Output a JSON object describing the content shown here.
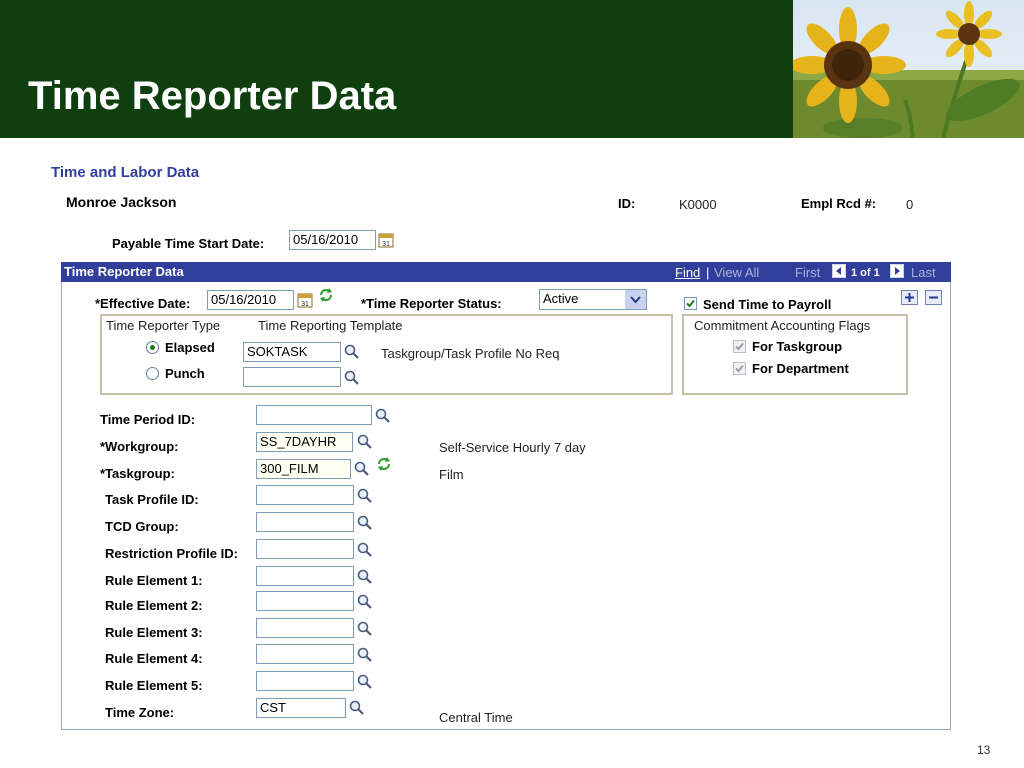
{
  "slide": {
    "title": "Time Reporter Data",
    "page_number": "13"
  },
  "section_title": "Time and Labor Data",
  "employee": {
    "name": "Monroe Jackson",
    "id_label": "ID:",
    "id_value": "K0000",
    "empl_rcd_label": "Empl Rcd #:",
    "empl_rcd_value": "0"
  },
  "payable": {
    "label": "Payable Time Start Date:",
    "value": "05/16/2010"
  },
  "grid": {
    "title": "Time Reporter Data",
    "find": "Find",
    "separator": "|",
    "view_all": "View All",
    "first": "First",
    "page_of": "1 of 1",
    "last": "Last"
  },
  "effective": {
    "label": "*Effective Date:",
    "value": "05/16/2010"
  },
  "status": {
    "label": "*Time Reporter Status:",
    "value": "Active"
  },
  "send_payroll": {
    "label": "Send Time to Payroll",
    "checked": true
  },
  "reporter_type": {
    "heading": "Time Reporter Type",
    "template_heading": "Time Reporting Template",
    "elapsed_label": "Elapsed",
    "punch_label": "Punch",
    "elapsed_template": "SOKTASK",
    "punch_template": "",
    "elapsed_desc": "Taskgroup/Task Profile No Req"
  },
  "commitment": {
    "heading": "Commitment Accounting Flags",
    "taskgroup_label": "For Taskgroup",
    "department_label": "For Department"
  },
  "fields": [
    {
      "label": "Time Period ID:",
      "value": "",
      "desc": ""
    },
    {
      "label": "*Workgroup:",
      "value": "SS_7DAYHR",
      "desc": "Self-Service Hourly 7 day"
    },
    {
      "label": "*Taskgroup:",
      "value": "300_FILM",
      "desc": "Film"
    },
    {
      "label": "Task Profile ID:",
      "value": "",
      "desc": ""
    },
    {
      "label": "TCD Group:",
      "value": "",
      "desc": ""
    },
    {
      "label": "Restriction Profile ID:",
      "value": "",
      "desc": ""
    },
    {
      "label": "Rule Element 1:",
      "value": "",
      "desc": ""
    },
    {
      "label": "Rule Element 2:",
      "value": "",
      "desc": ""
    },
    {
      "label": "Rule Element 3:",
      "value": "",
      "desc": ""
    },
    {
      "label": "Rule Element 4:",
      "value": "",
      "desc": ""
    },
    {
      "label": "Rule Element 5:",
      "value": "",
      "desc": ""
    },
    {
      "label": "Time Zone:",
      "value": "CST",
      "desc": "Central Time"
    }
  ],
  "colors": {
    "banner": "#0f3f0f",
    "grid_header": "#323e9c",
    "section_title": "#323e9c",
    "link": "#ffffff"
  },
  "icons": [
    "sunflower-photo",
    "search-icon",
    "calendar-icon",
    "refresh-icon",
    "plus-icon",
    "minus-icon",
    "dropdown-icon",
    "nav-prev-icon",
    "nav-next-icon"
  ]
}
